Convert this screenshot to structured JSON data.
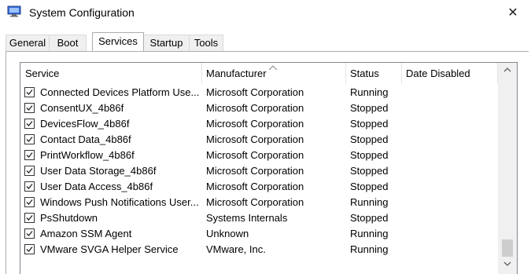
{
  "window": {
    "title": "System Configuration",
    "close_glyph": "✕",
    "app_icon": "system-configuration-icon"
  },
  "tabs": [
    {
      "label": "General",
      "active": false
    },
    {
      "label": "Boot",
      "active": false
    },
    {
      "label": "Services",
      "active": true
    },
    {
      "label": "Startup",
      "active": false
    },
    {
      "label": "Tools",
      "active": false
    }
  ],
  "columns": {
    "service": "Service",
    "manufacturer": "Manufacturer",
    "status": "Status",
    "date_disabled": "Date Disabled",
    "sorted_by": "Manufacturer"
  },
  "services": [
    {
      "name": "Connected Devices Platform Use...",
      "manufacturer": "Microsoft Corporation",
      "status": "Running",
      "date_disabled": "",
      "checked": true
    },
    {
      "name": "ConsentUX_4b86f",
      "manufacturer": "Microsoft Corporation",
      "status": "Stopped",
      "date_disabled": "",
      "checked": true
    },
    {
      "name": "DevicesFlow_4b86f",
      "manufacturer": "Microsoft Corporation",
      "status": "Stopped",
      "date_disabled": "",
      "checked": true
    },
    {
      "name": "Contact Data_4b86f",
      "manufacturer": "Microsoft Corporation",
      "status": "Stopped",
      "date_disabled": "",
      "checked": true
    },
    {
      "name": "PrintWorkflow_4b86f",
      "manufacturer": "Microsoft Corporation",
      "status": "Stopped",
      "date_disabled": "",
      "checked": true
    },
    {
      "name": "User Data Storage_4b86f",
      "manufacturer": "Microsoft Corporation",
      "status": "Stopped",
      "date_disabled": "",
      "checked": true
    },
    {
      "name": "User Data Access_4b86f",
      "manufacturer": "Microsoft Corporation",
      "status": "Stopped",
      "date_disabled": "",
      "checked": true
    },
    {
      "name": "Windows Push Notifications User...",
      "manufacturer": "Microsoft Corporation",
      "status": "Running",
      "date_disabled": "",
      "checked": true
    },
    {
      "name": "PsShutdown",
      "manufacturer": "Systems Internals",
      "status": "Stopped",
      "date_disabled": "",
      "checked": true
    },
    {
      "name": "Amazon SSM Agent",
      "manufacturer": "Unknown",
      "status": "Running",
      "date_disabled": "",
      "checked": true
    },
    {
      "name": "VMware SVGA Helper Service",
      "manufacturer": "VMware, Inc.",
      "status": "Running",
      "date_disabled": "",
      "checked": true
    }
  ],
  "scroll": {
    "position": 0.95
  }
}
